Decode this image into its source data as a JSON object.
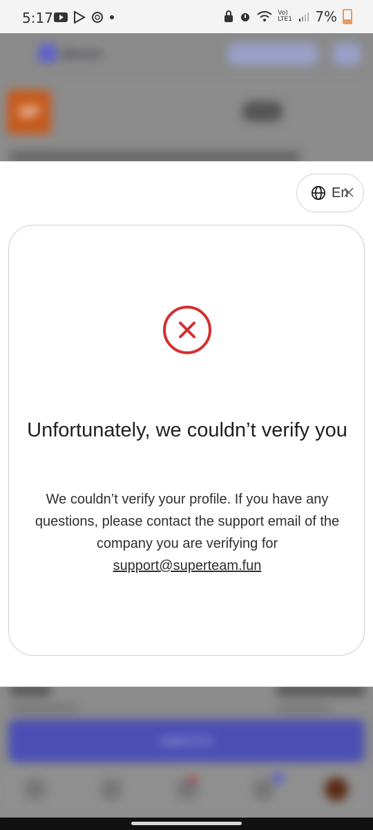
{
  "status_bar": {
    "time": "5:17",
    "network": "Vo) LTE1",
    "battery": "7%"
  },
  "background": {
    "logo_text": "alsorm",
    "thumb_text": "SP",
    "submit_label": "Submit KYC"
  },
  "modal": {
    "language_label": "En",
    "title": "Unfortunately, we couldn’t verify you",
    "description": "We couldn’t verify your profile. If you have any questions, please contact the support email of the company you are verifying for",
    "support_email": "support@superteam.fun"
  },
  "colors": {
    "error_red": "#d32f2f",
    "accent": "#4b4fb3",
    "battery": "#e69a5e"
  }
}
